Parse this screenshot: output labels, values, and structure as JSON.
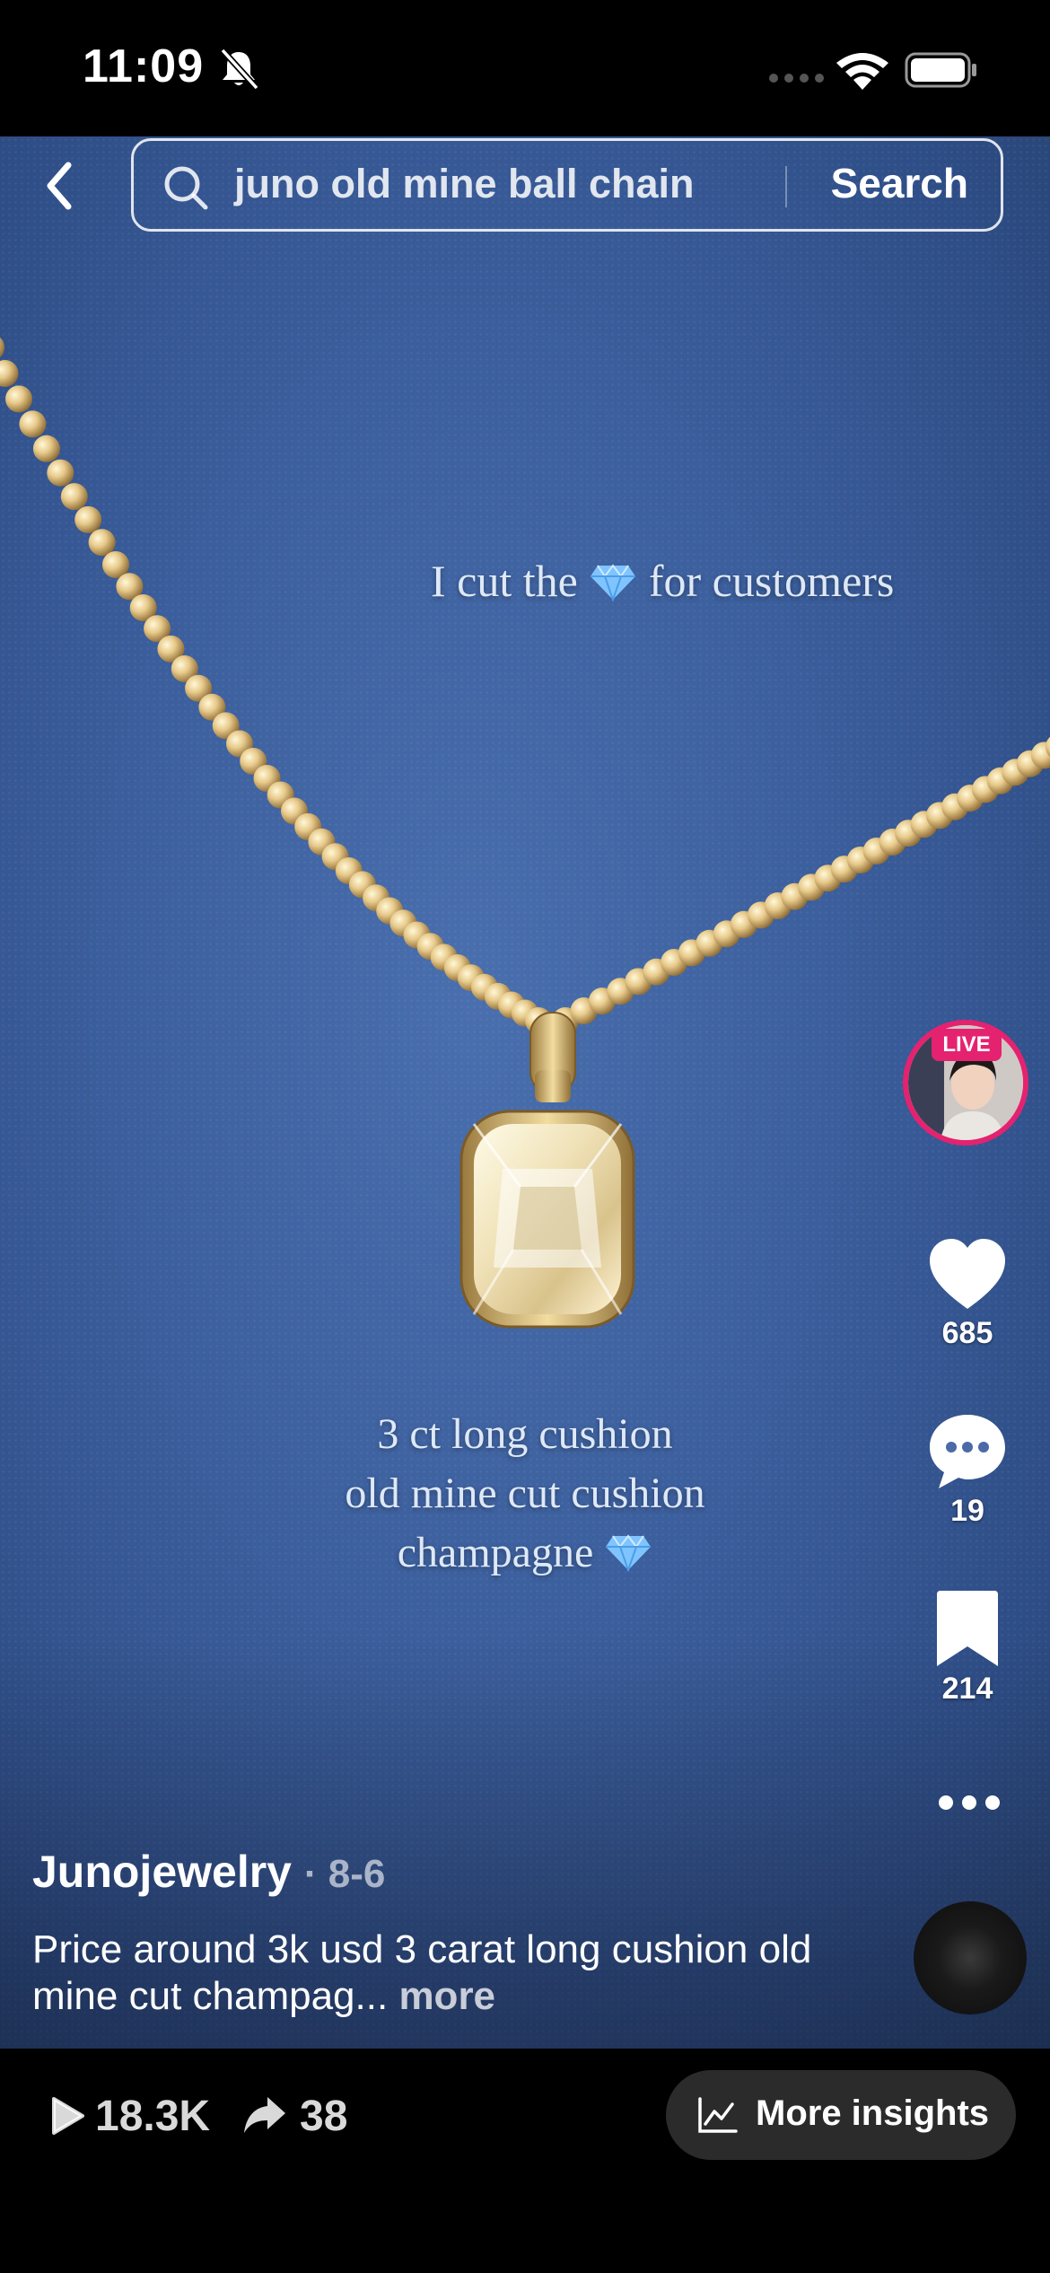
{
  "status_bar": {
    "time": "11:09"
  },
  "search": {
    "query": "juno old mine ball chain",
    "button_label": "Search"
  },
  "overlay": {
    "caption_top_before": "I cut the",
    "caption_top_after": "for customers",
    "caption_bottom_line1": "3 ct long cushion",
    "caption_bottom_line2": "old mine cut cushion",
    "caption_bottom_line3": "champagne"
  },
  "live": {
    "badge": "LIVE"
  },
  "actions": {
    "likes": "685",
    "comments": "19",
    "saves": "214"
  },
  "post": {
    "author": "Junojewelry",
    "date": "· 8-6",
    "description": "Price around 3k usd 3 carat long cushion old mine cut champag...",
    "more": "more"
  },
  "stats": {
    "views": "18.3K",
    "shares": "38",
    "insights_label": "More insights"
  },
  "icons": [
    "bell-off-icon",
    "signal-icon",
    "wifi-icon",
    "battery-icon",
    "back-icon",
    "search-icon",
    "gem-icon",
    "heart-icon",
    "comment-icon",
    "bookmark-icon",
    "more-icon",
    "play-icon",
    "share-icon",
    "chart-icon"
  ],
  "colors": {
    "live_accent": "#e5226f",
    "background_blue": "#3b5e9c",
    "bar_black": "#000000"
  }
}
